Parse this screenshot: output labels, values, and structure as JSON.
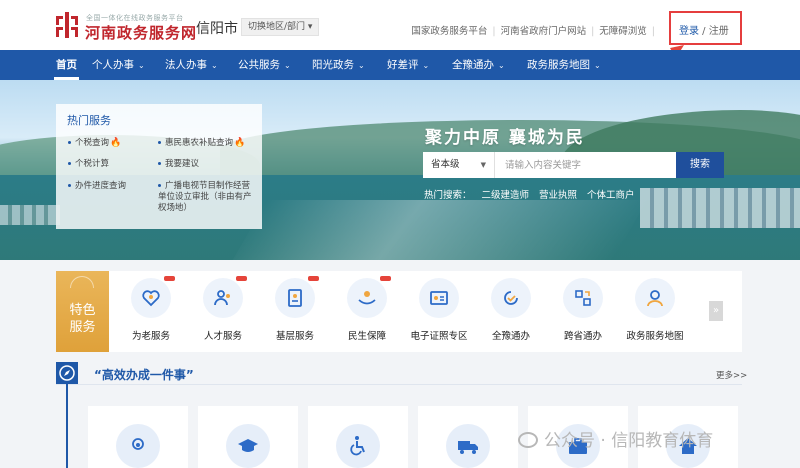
{
  "header": {
    "logo_small": "全国一体化在线政务服务平台",
    "logo_main": "河南政务服务网",
    "city": "信阳市",
    "switch_label": "切换地区/部门 ▾",
    "links": [
      "国家政务服务平台",
      "河南省政府门户网站",
      "无障碍浏览"
    ],
    "login": "登录",
    "register": "注册",
    "login_sep": " / ",
    "brand_color": "#c0262d"
  },
  "nav": {
    "items": [
      {
        "label": "首页",
        "dropdown": false
      },
      {
        "label": "个人办事",
        "dropdown": true
      },
      {
        "label": "法人办事",
        "dropdown": true
      },
      {
        "label": "公共服务",
        "dropdown": true
      },
      {
        "label": "阳光政务",
        "dropdown": true
      },
      {
        "label": "好差评",
        "dropdown": true
      },
      {
        "label": "全豫通办",
        "dropdown": true
      },
      {
        "label": "政务服务地图",
        "dropdown": true
      }
    ],
    "chevron": "⌄",
    "color": "#1f58a8"
  },
  "hot_services": {
    "title": "热门服务",
    "items": [
      {
        "label": "个税查询",
        "fire": true
      },
      {
        "label": "惠民惠农补贴查询",
        "fire": true
      },
      {
        "label": "个税计算",
        "fire": false
      },
      {
        "label": "我要建议",
        "fire": false
      },
      {
        "label": "办件进度查询",
        "fire": false
      },
      {
        "label": "广播电视节目制作经营单位设立审批（非由有产权场地）",
        "fire": false
      }
    ],
    "fire_glyph": "🔥"
  },
  "banner": {
    "slogan": "聚力中原 襄城为民",
    "search_level": "省本级",
    "search_caret": "▼",
    "search_placeholder": "请输入内容关键字",
    "search_button": "搜索",
    "hot_search_label": "热门搜索：",
    "hot_search_items": [
      "二级建造师",
      "营业执照",
      "个体工商户"
    ]
  },
  "featured": {
    "label_line1": "特色",
    "label_line2": "服务",
    "items": [
      {
        "label": "为老服务",
        "icon": "elderly-heart-icon"
      },
      {
        "label": "人才服务",
        "icon": "people-icon"
      },
      {
        "label": "基层服务",
        "icon": "document-icon"
      },
      {
        "label": "民生保障",
        "icon": "hand-care-icon"
      },
      {
        "label": "电子证照专区",
        "icon": "id-card-icon"
      },
      {
        "label": "全豫通办",
        "icon": "cycle-check-icon"
      },
      {
        "label": "跨省通办",
        "icon": "transfer-icon"
      },
      {
        "label": "政务服务地图",
        "icon": "map-person-icon"
      }
    ],
    "next_glyph": "»",
    "accent": "#e5443a"
  },
  "section": {
    "title": "“高效办成一件事”",
    "more": "更多>>",
    "cards": [
      {
        "icon": "baby-icon"
      },
      {
        "icon": "graduation-cap-icon"
      },
      {
        "icon": "wheelchair-icon"
      },
      {
        "icon": "truck-icon"
      },
      {
        "icon": "briefcase-icon"
      },
      {
        "icon": "house-icon"
      }
    ]
  },
  "watermark": "公众号 · 信阳教育体育"
}
